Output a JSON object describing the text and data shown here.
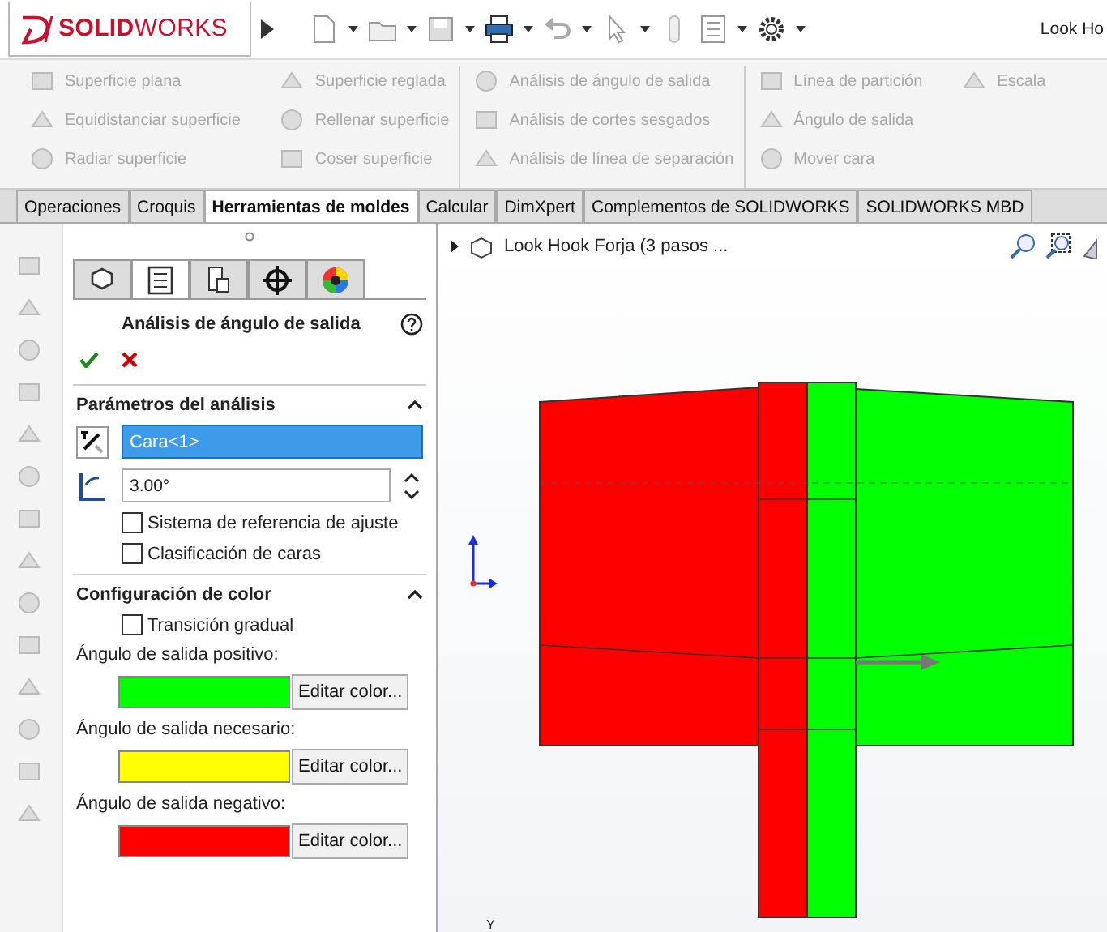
{
  "title_bar": {
    "logo": "**SOLID**WORKS",
    "document_title": "Look Ho"
  },
  "ribbon": {
    "columns": [
      {
        "items": [
          {
            "label": "Superficie plana",
            "disabled": true
          },
          {
            "label": "Equidistanciar superficie",
            "disabled": true
          },
          {
            "label": "Radiar superficie",
            "disabled": true
          }
        ]
      },
      {
        "items": [
          {
            "label": "Superficie reglada",
            "disabled": true
          },
          {
            "label": "Rellenar superficie",
            "disabled": true
          },
          {
            "label": "Coser superficie",
            "disabled": true
          }
        ]
      },
      {
        "items": [
          {
            "label": "Análisis de ángulo de salida",
            "disabled": true
          },
          {
            "label": "Análisis de cortes sesgados",
            "disabled": true
          },
          {
            "label": "Análisis de línea de separación",
            "disabled": true
          }
        ]
      },
      {
        "items": [
          {
            "label": "Línea de partición",
            "disabled": true
          },
          {
            "label": "Ángulo de salida",
            "disabled": true
          },
          {
            "label": "Mover cara",
            "disabled": true
          }
        ]
      },
      {
        "items": [
          {
            "label": "Escala",
            "disabled": true
          }
        ]
      }
    ]
  },
  "tabs": [
    {
      "label": "Operaciones",
      "selected": false
    },
    {
      "label": "Croquis",
      "selected": false
    },
    {
      "label": "Herramientas de moldes",
      "selected": true
    },
    {
      "label": "Calcular",
      "selected": false
    },
    {
      "label": "DimXpert",
      "selected": false
    },
    {
      "label": "Complementos de SOLIDWORKS",
      "selected": false
    },
    {
      "label": "SOLIDWORKS MBD",
      "selected": false
    }
  ],
  "property_manager": {
    "icon_tabs": [
      {
        "selected": false
      },
      {
        "selected": true
      },
      {
        "selected": false
      },
      {
        "selected": false
      },
      {
        "selected": false
      }
    ],
    "title": "Análisis de ángulo de salida",
    "sections": [
      {
        "kind": "parameters",
        "title": "Parámetros del análisis",
        "expanded": true,
        "face_field": "Cara<1>",
        "angle_field": "3.00°",
        "options": [
          {
            "label": "Sistema de referencia de ajuste",
            "checked": false
          },
          {
            "label": "Clasificación de caras",
            "checked": false
          }
        ]
      },
      {
        "kind": "colors",
        "title": "Configuración de color",
        "expanded": true,
        "options": [
          {
            "label": "Transición gradual",
            "checked": false
          }
        ],
        "colors": [
          {
            "label": "Ángulo de salida positivo:",
            "color": "#00ff00",
            "button": "Editar color..."
          },
          {
            "label": "Ángulo de salida necesario:",
            "color": "#ffff00",
            "button": "Editar color..."
          },
          {
            "label": "Ángulo de salida negativo:",
            "color": "#ff0000",
            "button": "Editar color..."
          }
        ]
      }
    ]
  },
  "viewport": {
    "tree_label": "Look Hook Forja (3 pasos ...",
    "axis_label": "Y"
  }
}
